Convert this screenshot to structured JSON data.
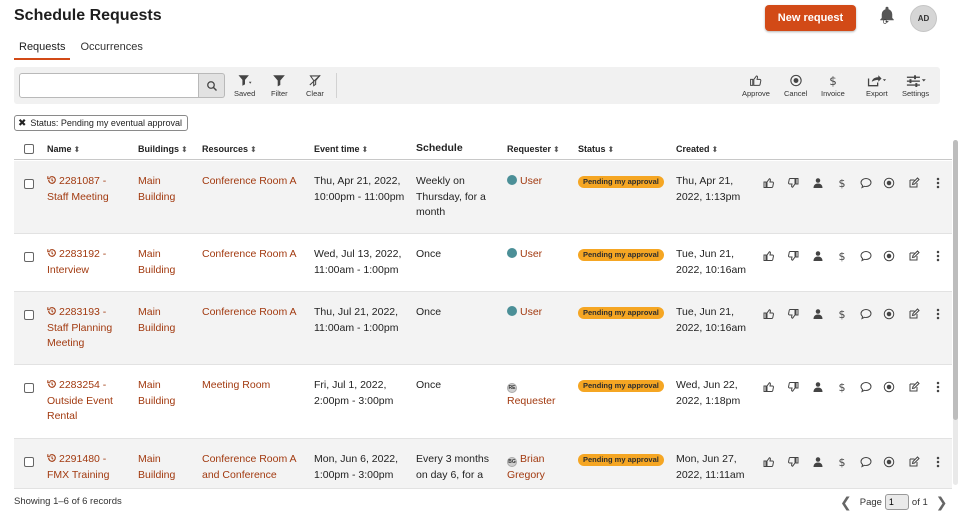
{
  "header": {
    "title": "Schedule Requests",
    "new_request_label": "New request",
    "notification_count": "0",
    "avatar_initials": "AD"
  },
  "tabs": [
    {
      "label": "Requests",
      "active": true
    },
    {
      "label": "Occurrences",
      "active": false
    }
  ],
  "toolbar": {
    "search_value": "",
    "search_placeholder": "",
    "saved_label": "Saved",
    "filter_label": "Filter",
    "clear_label": "Clear",
    "approve_label": "Approve",
    "cancel_label": "Cancel",
    "invoice_label": "Invoice",
    "export_label": "Export",
    "settings_label": "Settings"
  },
  "filter_chip": {
    "label": "Status: Pending my eventual approval"
  },
  "columns": {
    "name": "Name",
    "buildings": "Buildings",
    "resources": "Resources",
    "event_time": "Event time",
    "schedule": "Schedule",
    "requester": "Requester",
    "status": "Status",
    "created": "Created"
  },
  "rows": [
    {
      "name": [
        "2281087 -",
        "Staff Meeting"
      ],
      "building": [
        "Main",
        "Building"
      ],
      "resources": [
        "Conference Room A"
      ],
      "event_time": [
        "Thu, Apr 21, 2022,",
        "10:00pm - 11:00pm"
      ],
      "schedule": [
        "Weekly on",
        "Thursday, for a",
        "month"
      ],
      "requester": [
        "User"
      ],
      "requester_initials": "",
      "status": "Pending my approval",
      "created": [
        "Thu, Apr 21,",
        "2022, 1:13pm"
      ]
    },
    {
      "name": [
        "2283192 -",
        "Interview"
      ],
      "building": [
        "Main",
        "Building"
      ],
      "resources": [
        "Conference Room A"
      ],
      "event_time": [
        "Wed, Jul 13, 2022,",
        "11:00am - 1:00pm"
      ],
      "schedule": [
        "Once"
      ],
      "requester": [
        "User"
      ],
      "requester_initials": "",
      "status": "Pending my approval",
      "created": [
        "Tue, Jun 21,",
        "2022, 10:16am"
      ]
    },
    {
      "name": [
        "2283193 -",
        "Staff Planning",
        "Meeting"
      ],
      "building": [
        "Main",
        "Building"
      ],
      "resources": [
        "Conference Room A"
      ],
      "event_time": [
        "Thu, Jul 21, 2022,",
        "11:00am - 1:00pm"
      ],
      "schedule": [
        "Once"
      ],
      "requester": [
        "User"
      ],
      "requester_initials": "",
      "status": "Pending my approval",
      "created": [
        "Tue, Jun 21,",
        "2022, 10:16am"
      ]
    },
    {
      "name": [
        "2283254 -",
        "Outside Event",
        "Rental"
      ],
      "building": [
        "Main",
        "Building"
      ],
      "resources": [
        "Meeting Room"
      ],
      "event_time": [
        "Fri, Jul 1, 2022,",
        "2:00pm - 3:00pm"
      ],
      "schedule": [
        "Once"
      ],
      "requester": [
        "",
        "Requester"
      ],
      "requester_initials": "RE",
      "status": "Pending my approval",
      "created": [
        "Wed, Jun 22,",
        "2022, 1:18pm"
      ]
    },
    {
      "name": [
        "2291480 -",
        "FMX Training"
      ],
      "building": [
        "Main",
        "Building"
      ],
      "resources": [
        "Conference Room A",
        "and Conference"
      ],
      "event_time": [
        "Mon, Jun 6, 2022,",
        "1:00pm - 3:00pm"
      ],
      "schedule": [
        "Every 3 months",
        "on day 6, for a"
      ],
      "requester": [
        "Brian",
        "Gregory"
      ],
      "requester_initials": "BG",
      "status": "Pending my approval",
      "created": [
        "Mon, Jun 27,",
        "2022, 11:11am"
      ]
    }
  ],
  "footer": {
    "showing": "Showing 1–6 of 6 records",
    "page_label": "Page",
    "page_value": "1",
    "of_label": "of 1"
  },
  "colors": {
    "accent": "#d24a17",
    "link": "#a23a10",
    "badge": "#f5a623"
  }
}
